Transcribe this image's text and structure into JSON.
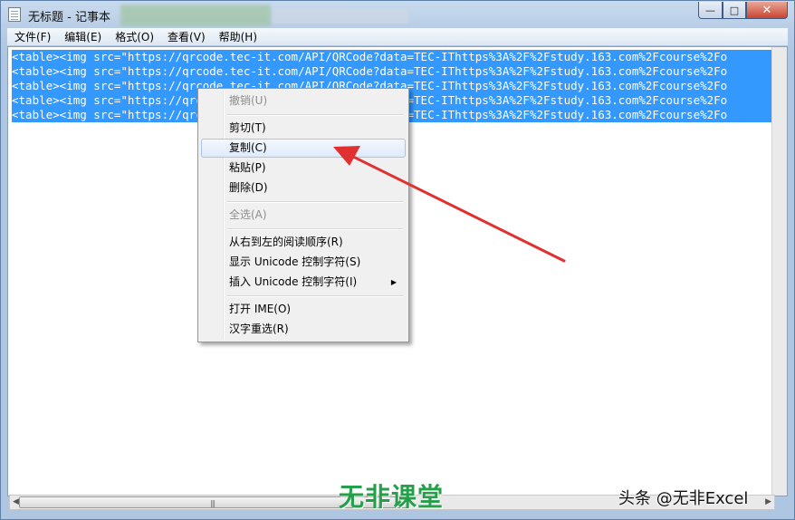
{
  "window": {
    "title": "无标题 - 记事本"
  },
  "controls": {
    "minimize": "—",
    "maximize": "□",
    "close": "✕"
  },
  "menu": [
    "文件(F)",
    "编辑(E)",
    "格式(O)",
    "查看(V)",
    "帮助(H)"
  ],
  "editor_lines": [
    "<table><img src=\"https://qrcode.tec-it.com/API/QRCode?data=TEC-IThttps%3A%2F%2Fstudy.163.com%2Fcourse%2Fo",
    "<table><img src=\"https://qrcode.tec-it.com/API/QRCode?data=TEC-IThttps%3A%2F%2Fstudy.163.com%2Fcourse%2Fo",
    "<table><img src=\"https://qrcode.tec-it.com/API/QRCode?data=TEC-IThttps%3A%2F%2Fstudy.163.com%2Fcourse%2Fo",
    "<table><img src=\"https://qrcode.tec-it.com/API/QRCode?data=TEC-IThttps%3A%2F%2Fstudy.163.com%2Fcourse%2Fo",
    "<table><img src=\"https://qrcode.tec-it.com/API/QRCode?data=TEC-IThttps%3A%2F%2Fstudy.163.com%2Fcourse%2Fo"
  ],
  "context_menu": {
    "undo": "撤销(U)",
    "cut": "剪切(T)",
    "copy": "复制(C)",
    "paste": "粘贴(P)",
    "delete": "删除(D)",
    "select_all": "全选(A)",
    "rtl": "从右到左的阅读顺序(R)",
    "show_unicode": "显示 Unicode 控制字符(S)",
    "insert_unicode": "插入 Unicode 控制字符(I)",
    "submenu_glyph": "▶",
    "open_ime": "打开 IME(O)",
    "reconversion": "汉字重选(R)"
  },
  "scrollbar": {
    "left_arrow": "◀",
    "right_arrow": "▶",
    "grip": "|||"
  },
  "watermark": {
    "brand": "无非课堂",
    "credit": "头条 @无非Excel"
  },
  "colors": {
    "selection": "#3399ff",
    "arrow": "#e03030",
    "brand": "#24a04a"
  }
}
